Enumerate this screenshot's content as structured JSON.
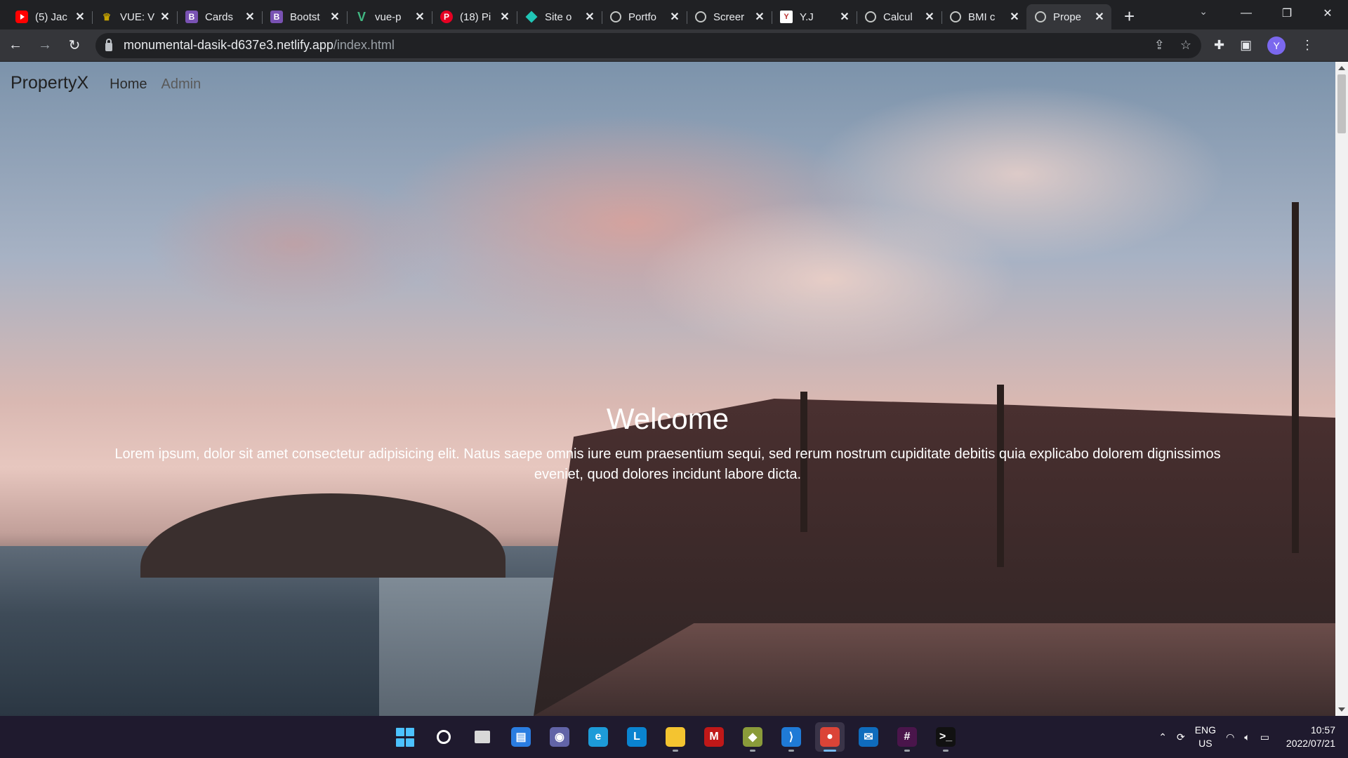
{
  "browser": {
    "tabs": [
      {
        "title": "(5) Jac",
        "favicon": "youtube-icon",
        "active": false
      },
      {
        "title": "VUE: V",
        "favicon": "vue-school-icon",
        "active": false
      },
      {
        "title": "Cards",
        "favicon": "bootstrap-icon",
        "active": false
      },
      {
        "title": "Bootst",
        "favicon": "bootstrap-icon",
        "active": false
      },
      {
        "title": "vue-p",
        "favicon": "vue-icon",
        "active": false
      },
      {
        "title": "(18) Pi",
        "favicon": "pinterest-icon",
        "active": false
      },
      {
        "title": "Site o",
        "favicon": "netlify-icon",
        "active": false
      },
      {
        "title": "Portfo",
        "favicon": "globe-icon",
        "active": false
      },
      {
        "title": "Screer",
        "favicon": "globe-icon",
        "active": false
      },
      {
        "title": "Y.J",
        "favicon": "yj-icon",
        "active": false
      },
      {
        "title": "Calcul",
        "favicon": "globe-icon",
        "active": false
      },
      {
        "title": "BMI c",
        "favicon": "globe-icon",
        "active": false
      },
      {
        "title": "Prope",
        "favicon": "globe-icon",
        "active": true
      }
    ],
    "new_tab_label": "+",
    "url_host": "monumental-dasik-d637e3.netlify.app",
    "url_path": "/index.html",
    "profile_initial": "Y"
  },
  "site": {
    "brand": "PropertyX",
    "nav": [
      "Home",
      "Admin"
    ],
    "hero_title": "Welcome",
    "hero_text": "Lorem ipsum, dolor sit amet consectetur adipisicing elit. Natus saepe omnis iure eum praesentium sequi, sed rerum nostrum cupiditate debitis quia explicabo dolorem dignissimos eveniet, quod dolores incidunt labore dicta."
  },
  "taskbar": {
    "apps": [
      "windows-start-icon",
      "search-icon",
      "task-view-icon",
      "widgets-icon",
      "teams-chat-icon",
      "edge-icon",
      "l-app-icon",
      "file-explorer-icon",
      "mcafee-icon",
      "git-icon",
      "vscode-icon",
      "chrome-icon",
      "mail-icon",
      "slack-icon",
      "terminal-icon"
    ],
    "lang_top": "ENG",
    "lang_bottom": "US",
    "time": "10:57",
    "date": "2022/07/21"
  },
  "colors": {
    "tabstrip": "#202124",
    "toolbar": "#35363a",
    "taskbar": "#1f1a2e",
    "accent": "#76b9ed"
  }
}
